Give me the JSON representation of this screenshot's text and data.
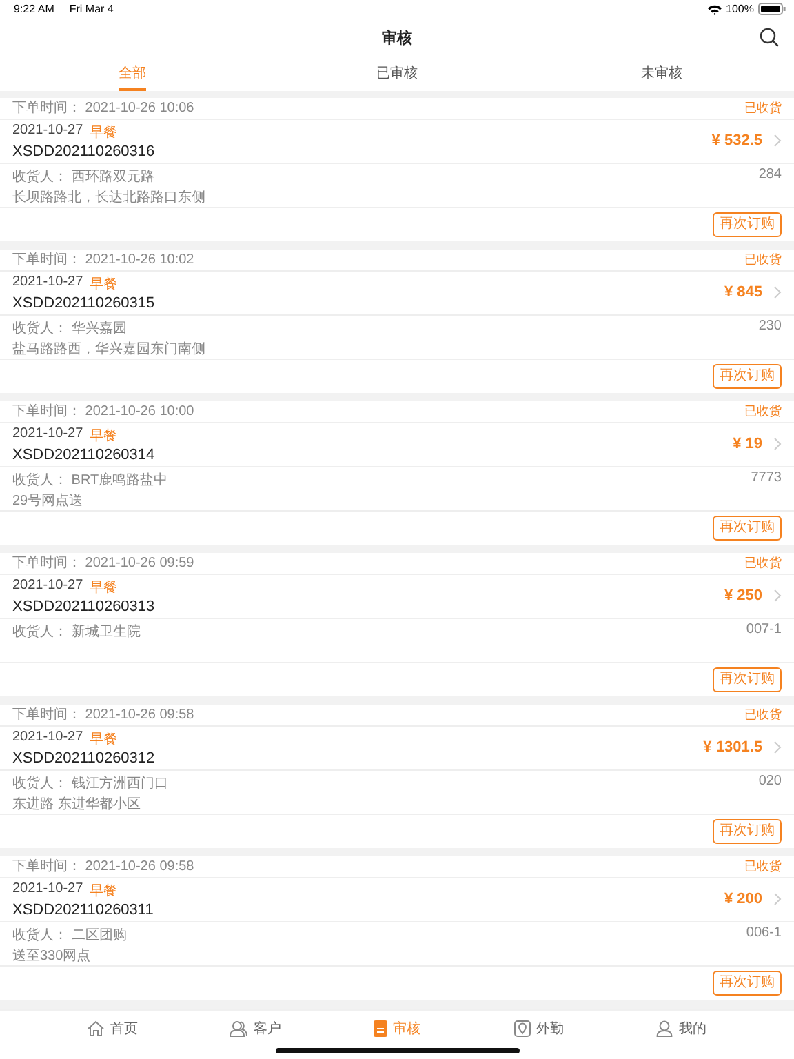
{
  "status_bar": {
    "time": "9:22 AM",
    "date": "Fri Mar 4",
    "battery": "100%"
  },
  "nav": {
    "title": "审核"
  },
  "tabs": [
    {
      "label": "全部",
      "selected": true
    },
    {
      "label": "已审核",
      "selected": false
    },
    {
      "label": "未审核",
      "selected": false
    }
  ],
  "orders": [
    {
      "order_time_label": "下单时间：",
      "order_time": "2021-10-26 10:06",
      "status": "已收货",
      "date": "2021-10-27",
      "meal": "早餐",
      "number": "XSDD202110260316",
      "amount": "¥ 532.5",
      "receiver_label": "收货人：",
      "receiver": "西环路双元路",
      "code": "284",
      "address": "长坝路路北，长达北路路口东侧",
      "button": "再次订购"
    },
    {
      "order_time_label": "下单时间：",
      "order_time": "2021-10-26 10:02",
      "status": "已收货",
      "date": "2021-10-27",
      "meal": "早餐",
      "number": "XSDD202110260315",
      "amount": "¥ 845",
      "receiver_label": "收货人：",
      "receiver": "华兴嘉园",
      "code": "230",
      "address": "盐马路路西，华兴嘉园东门南侧",
      "button": "再次订购"
    },
    {
      "order_time_label": "下单时间：",
      "order_time": "2021-10-26 10:00",
      "status": "已收货",
      "date": "2021-10-27",
      "meal": "早餐",
      "number": "XSDD202110260314",
      "amount": "¥ 19",
      "receiver_label": "收货人：",
      "receiver": "BRT鹿鸣路盐中",
      "code": "7773",
      "address": "29号网点送",
      "button": "再次订购"
    },
    {
      "order_time_label": "下单时间：",
      "order_time": "2021-10-26 09:59",
      "status": "已收货",
      "date": "2021-10-27",
      "meal": "早餐",
      "number": "XSDD202110260313",
      "amount": "¥ 250",
      "receiver_label": "收货人：",
      "receiver": "新城卫生院",
      "code": "007-1",
      "button": "再次订购"
    },
    {
      "order_time_label": "下单时间：",
      "order_time": "2021-10-26 09:58",
      "status": "已收货",
      "date": "2021-10-27",
      "meal": "早餐",
      "number": "XSDD202110260312",
      "amount": "¥ 1301.5",
      "receiver_label": "收货人：",
      "receiver": "钱江方洲西门口",
      "code": "020",
      "address": "东进路  东进华都小区",
      "button": "再次订购"
    },
    {
      "order_time_label": "下单时间：",
      "order_time": "2021-10-26 09:58",
      "status": "已收货",
      "date": "2021-10-27",
      "meal": "早餐",
      "number": "XSDD202110260311",
      "amount": "¥ 200",
      "receiver_label": "收货人：",
      "receiver": "二区团购",
      "code": "006-1",
      "address": "送至330网点",
      "button": "再次订购"
    }
  ],
  "tab_bar": [
    {
      "kind": "home",
      "label": "首页",
      "selected": false
    },
    {
      "kind": "customer",
      "label": "客户",
      "selected": false
    },
    {
      "kind": "review",
      "label": "审核",
      "selected": true
    },
    {
      "kind": "field",
      "label": "外勤",
      "selected": false
    },
    {
      "kind": "me",
      "label": "我的",
      "selected": false
    }
  ]
}
